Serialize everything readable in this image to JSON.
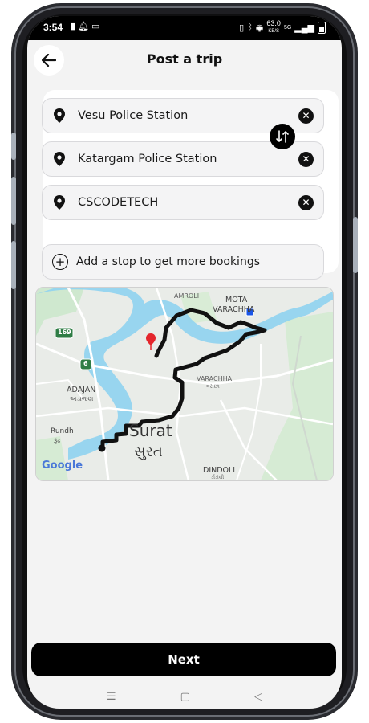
{
  "status_bar": {
    "time": "3:54",
    "left_icons": [
      "sim-icon",
      "bell-icon",
      "laptop-icon"
    ],
    "net_speed": "63.0",
    "net_unit": "KB/S",
    "net_type": "5G"
  },
  "header": {
    "title": "Post a trip"
  },
  "trip": {
    "fields": [
      {
        "value": "Vesu Police Station"
      },
      {
        "value": "Katargam Police Station"
      },
      {
        "value": "CSCODETECH"
      }
    ],
    "add_stop_label": "Add a stop to get more bookings"
  },
  "map": {
    "labels": {
      "amroli": "AMROLI",
      "mota": "MOTA",
      "varachha_mota": "VARACHHA",
      "varachha": "VARACHHA",
      "varachha_guj": "વરાછા",
      "adajan": "ADAJAN",
      "adajan_guj": "અડાજણ",
      "rundh": "Rundh",
      "rundh_guj": "રૂંઢ",
      "surat": "Surat",
      "surat_guj": "સુરત",
      "dindoli": "DINDOLI",
      "dindoli_guj": "ડીંડોલી",
      "road_169": "169",
      "road_6": "6",
      "google": "Google"
    },
    "colors": {
      "route": "#111111",
      "water": "#8fd3ef",
      "land": "#e9ece8",
      "green": "#cfe8cf"
    }
  },
  "actions": {
    "next_label": "Next"
  },
  "nav_icons": [
    "menu-icon",
    "home-icon",
    "back-triangle-icon"
  ]
}
